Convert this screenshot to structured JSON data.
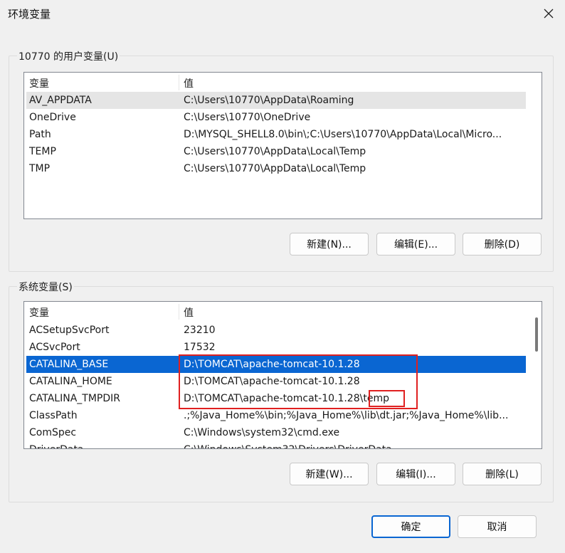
{
  "window": {
    "title": "环境变量"
  },
  "user_group": {
    "title": "10770 的用户变量(U)",
    "col_var": "变量",
    "col_val": "值",
    "rows": [
      {
        "name": "AV_APPDATA",
        "value": "C:\\Users\\10770\\AppData\\Roaming"
      },
      {
        "name": "OneDrive",
        "value": "C:\\Users\\10770\\OneDrive"
      },
      {
        "name": "Path",
        "value": "D:\\MYSQL_SHELL8.0\\bin\\;C:\\Users\\10770\\AppData\\Local\\Micro..."
      },
      {
        "name": "TEMP",
        "value": "C:\\Users\\10770\\AppData\\Local\\Temp"
      },
      {
        "name": "TMP",
        "value": "C:\\Users\\10770\\AppData\\Local\\Temp"
      }
    ],
    "new_label": "新建(N)...",
    "edit_label": "编辑(E)...",
    "delete_label": "删除(D)"
  },
  "system_group": {
    "title": "系统变量(S)",
    "col_var": "变量",
    "col_val": "值",
    "rows": [
      {
        "name": "ACSetupSvcPort",
        "value": "23210"
      },
      {
        "name": "ACSvcPort",
        "value": "17532"
      },
      {
        "name": "CATALINA_BASE",
        "value": "D:\\TOMCAT\\apache-tomcat-10.1.28"
      },
      {
        "name": "CATALINA_HOME",
        "value": "D:\\TOMCAT\\apache-tomcat-10.1.28"
      },
      {
        "name": "CATALINA_TMPDIR",
        "value": "D:\\TOMCAT\\apache-tomcat-10.1.28\\temp"
      },
      {
        "name": "ClassPath",
        "value": ".;%Java_Home%\\bin;%Java_Home%\\lib\\dt.jar;%Java_Home%\\lib..."
      },
      {
        "name": "ComSpec",
        "value": "C:\\Windows\\system32\\cmd.exe"
      },
      {
        "name": "DriverData",
        "value": "C:\\Windows\\System32\\Drivers\\DriverData"
      }
    ],
    "new_label": "新建(W)...",
    "edit_label": "编辑(I)...",
    "delete_label": "删除(L)"
  },
  "footer": {
    "ok_label": "确定",
    "cancel_label": "取消"
  },
  "colors": {
    "selection": "#0a66d2",
    "highlight_box": "#e02020"
  }
}
